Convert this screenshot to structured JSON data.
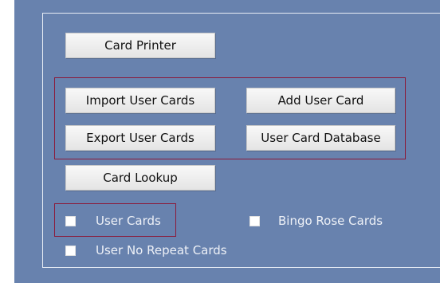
{
  "buttons": {
    "card_printer": "Card Printer",
    "import_user_cards": "Import User Cards",
    "add_user_card": "Add User Card",
    "export_user_cards": "Export User Cards",
    "user_card_database": "User Card Database",
    "card_lookup": "Card Lookup"
  },
  "checkboxes": {
    "user_cards": {
      "label": "User Cards",
      "checked": false
    },
    "bingo_rose_cards": {
      "label": "Bingo Rose Cards",
      "checked": false
    },
    "user_no_repeat_cards": {
      "label": "User No Repeat Cards",
      "checked": false
    }
  },
  "colors": {
    "panel_background": "#6882ae",
    "frame_border": "#e8edf5",
    "group_highlight_border": "#8b1a3a",
    "button_background": "#f0f0f0",
    "label_text": "#eef1f7"
  }
}
